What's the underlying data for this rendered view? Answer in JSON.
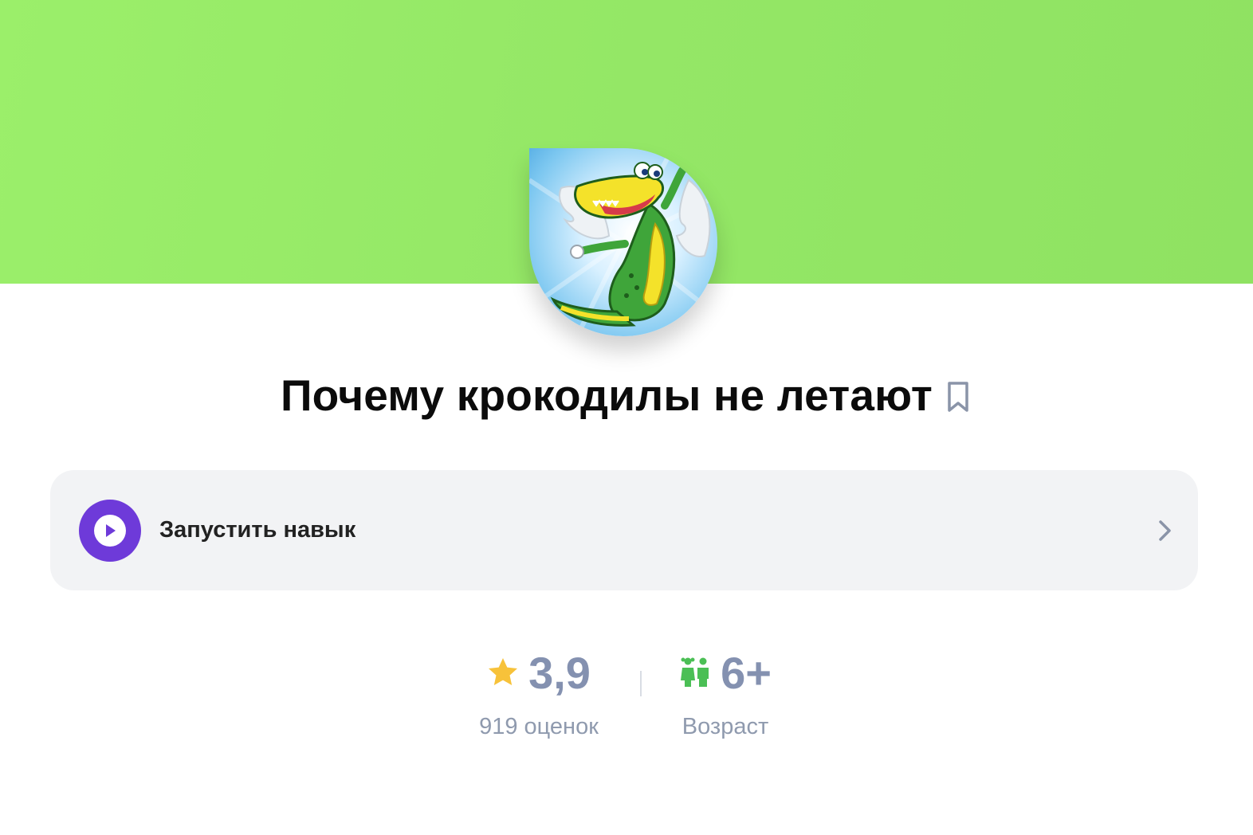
{
  "colors": {
    "banner": "#95e866",
    "card_background": "#f2f3f5",
    "play_button": "#6e3ad9",
    "star": "#f7c23a",
    "age_icon": "#4bbf55",
    "stat_text": "#8491b0"
  },
  "skill": {
    "logo_icon": "crocodile-with-wings-icon",
    "title": "Почему крокодилы не летают",
    "bookmark_icon": "bookmark-icon"
  },
  "launch": {
    "label": "Запустить навык",
    "play_icon": "play-icon",
    "chevron_icon": "chevron-right-icon"
  },
  "stats": {
    "rating": {
      "icon": "star-icon",
      "value": "3,9",
      "caption": "919 оценок"
    },
    "age": {
      "icon": "children-icon",
      "value": "6+",
      "caption": "Возраст"
    }
  }
}
